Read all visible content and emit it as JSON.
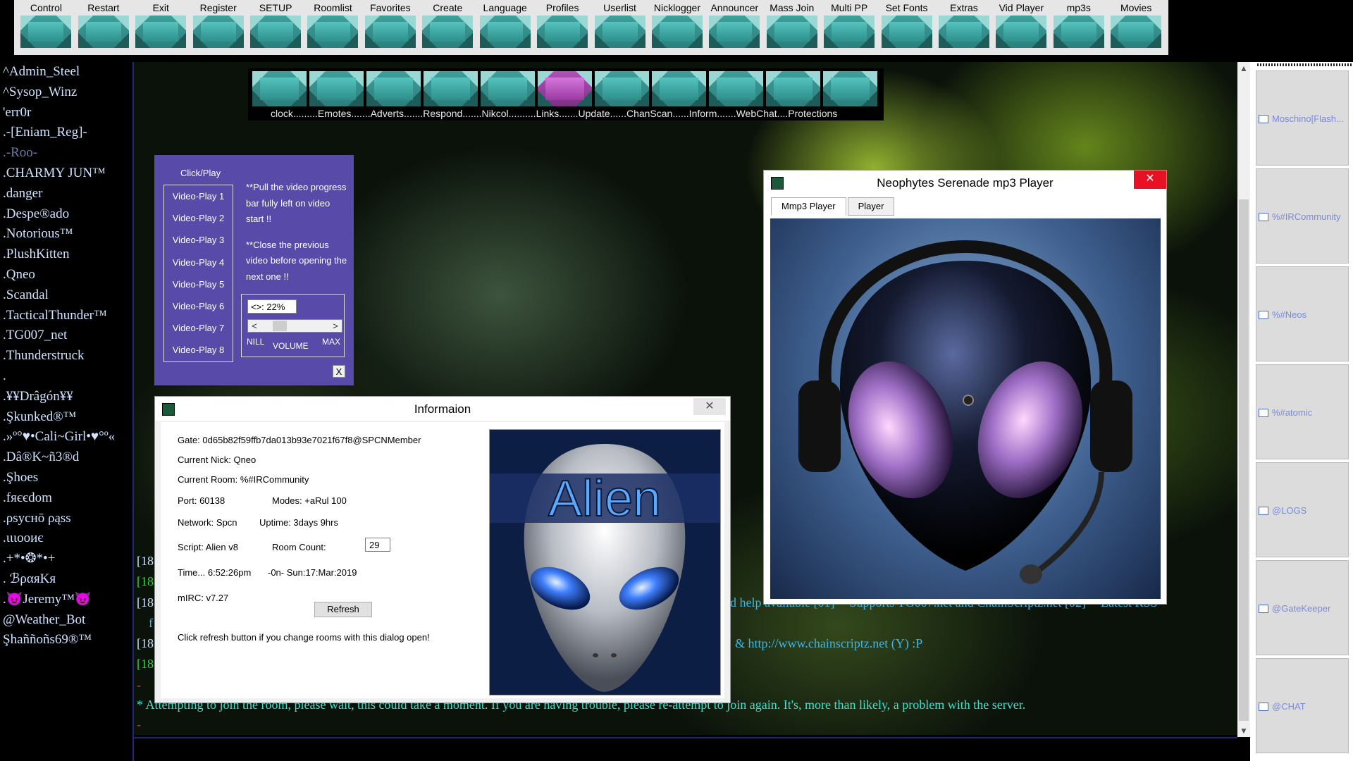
{
  "toolbar": {
    "buttons": [
      "Control",
      "Restart",
      "Exit",
      "Register",
      "SETUP",
      "Roomlist",
      "Favorites",
      "Create",
      "Language",
      "Profiles",
      "Userlist",
      "Nicklogger",
      "Announcer",
      "Mass Join",
      "Multi PP",
      "Set Fonts",
      "Extras",
      "Vid Player",
      "mp3s",
      "Movies"
    ]
  },
  "submenu": {
    "labels": "clock.........Emotes.......Adverts.......Respond.......Nikcol..........Links.......Update......ChanScan......Inform.......WebChat....Protections",
    "active_color": "#a33fa9"
  },
  "nicklist": [
    "^Admin_Steel",
    "^Sysop_Winz",
    "'err0r",
    ".-[Eniam_Reg]-",
    ".-Roo-",
    ".CHARMY JUN™",
    ".danger",
    ".Despe®ado",
    ".Notorious™",
    ".PlushKitten",
    ".Qneo",
    ".Scandal",
    ".TacticalThunder™",
    ".TG007_net",
    ".Thunderstruck",
    ".",
    ".¥¥Drâgón¥¥",
    ".Şkunked®™",
    ".»º°♥•Cali~Girl•♥°º«",
    ".Dâ®K~ñ3®d",
    ".Şhoes",
    ".fяєєdom",
    ".ρѕуcнō ρąss",
    ".ιιιοοиє",
    ".+*•❂*•+",
    ". ℬραяKя",
    ".😈Jeremy™😈",
    "@Weather_Bot",
    "Şhaññoñs69®™"
  ],
  "video_panel": {
    "title": "Click/Play",
    "items": [
      "Video-Play 1",
      "Video-Play 2",
      "Video-Play 3",
      "Video-Play 4",
      "Video-Play 5",
      "Video-Play 6",
      "Video-Play 7",
      "Video-Play 8"
    ],
    "note1": "**Pull the video progress bar fully left on video start !!",
    "note2": "**Close the previous video before opening the next one !!",
    "volume_display": "<>: 22%",
    "volume_level": 0.22,
    "nill_label": "NILL",
    "volume_label": "VOLUME",
    "max_label": "MAX",
    "close_label": "X"
  },
  "info_dialog": {
    "title": "Informaion",
    "close_glyph": "✕",
    "gate": "Gate: 0d65b82f59ffb7da013b93e7021f67f8@SPCNMember",
    "nick": "Current Nick: Qneo",
    "room": "Current Room: %#IRCommunity",
    "port": "Port: 60138",
    "modes": "Modes: +aRul 100",
    "network": "Network: Spcn",
    "uptime": "Uptime: 3days 9hrs",
    "script": "Script: Alien v8",
    "room_count_label": "Room Count:",
    "room_count": "29",
    "time": "Time... 6:52:26pm",
    "date": "-0n- Sun:17:Mar:2019",
    "mirc": "mIRC: v7.27",
    "refresh_label": "Refresh",
    "hint": "Click refresh button if you change rooms with this dialog open!",
    "logo_text": "Alien"
  },
  "mp3_player": {
    "title": "Neophytes Serenade mp3 Player",
    "close_glyph": "✕",
    "tabs": [
      "Mmp3 Player",
      "Player"
    ]
  },
  "chat": {
    "line1": "[18",
    "line2": "[18",
    "line3": "[18",
    "line3_cont": "d help available [01] -- Supports TG007.net and ChainScriptz.net [02] -- Latest RSS",
    "line4_prefix": "f",
    "line5": "[18",
    "line5_cont": "& http://www.chainscriptz.net (Y) :P",
    "line6": "[18",
    "dash1": "-",
    "line7": "* Attempting to join the room, please wait, this could take a moment. If you are having trouble, please re-attempt to join again. It's, more than likely, a problem with the server.",
    "dash2": "-"
  },
  "right_panel": {
    "tiles": [
      "Moschino[Flash...",
      "%#IRCommunity",
      "%#Neos",
      "%#atomic",
      "@LOGS",
      "@GateKeeper",
      "@CHAT"
    ]
  },
  "scroll": {
    "up": "▲",
    "down": "▼"
  }
}
